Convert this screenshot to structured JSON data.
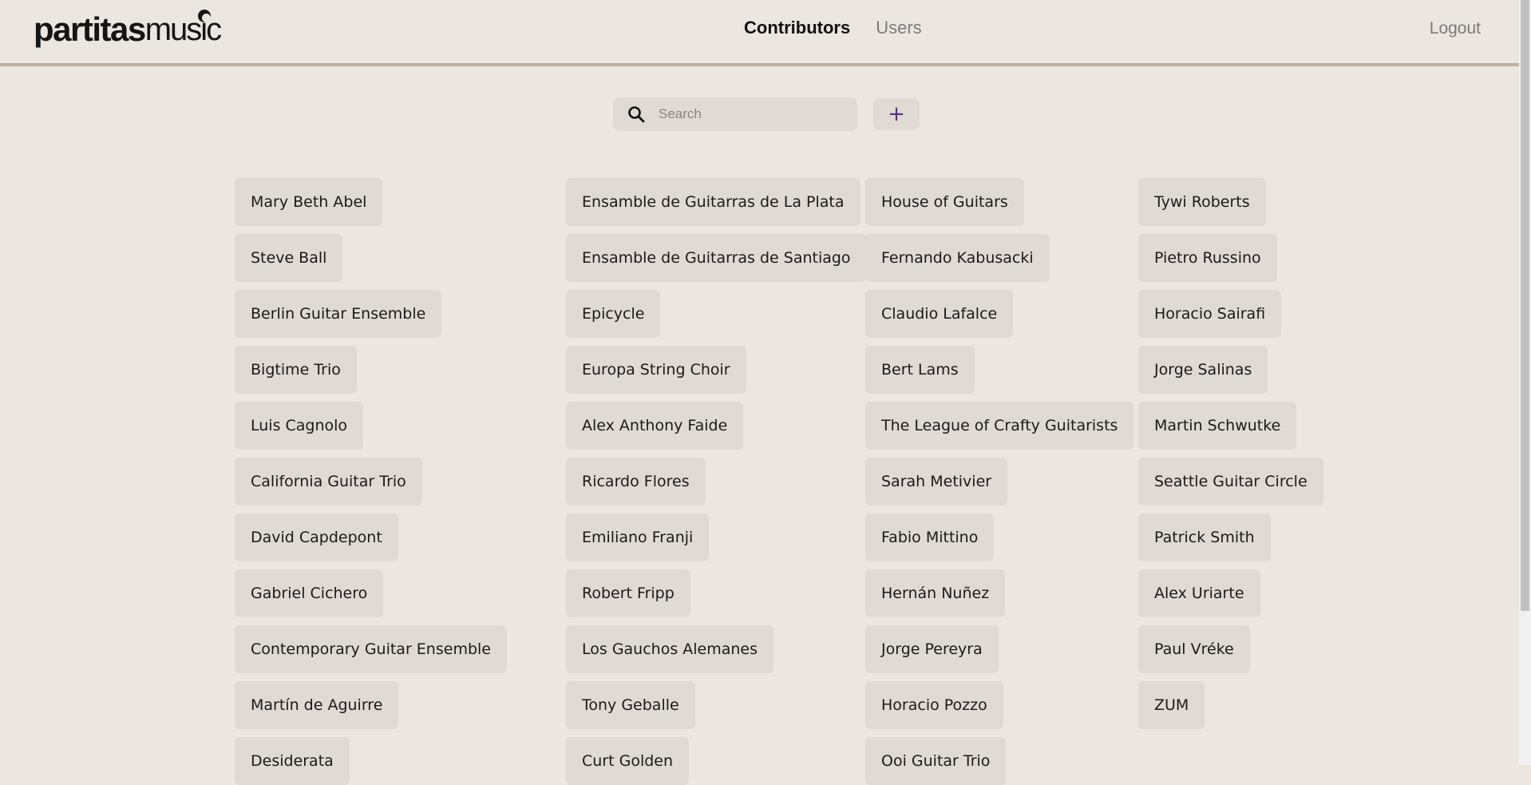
{
  "header": {
    "logo_bold": "partitas",
    "logo_thin": "music",
    "tabs": [
      {
        "label": "Contributors",
        "active": true
      },
      {
        "label": "Users",
        "active": false
      }
    ],
    "logout_label": "Logout"
  },
  "search": {
    "placeholder": "Search",
    "value": "",
    "add_label": "+"
  },
  "contributors": [
    [
      "Mary Beth Abel",
      "Steve Ball",
      "Berlin Guitar Ensemble",
      "Bigtime Trio",
      "Luis Cagnolo",
      "California Guitar Trio",
      "David Capdepont",
      "Gabriel Cichero",
      "Contemporary Guitar Ensemble",
      "Martín de Aguirre",
      "Desiderata"
    ],
    [
      "Ensamble de Guitarras de La Plata",
      "Ensamble de Guitarras de Santiago",
      "Epicycle",
      "Europa String Choir",
      "Alex Anthony Faide",
      "Ricardo Flores",
      "Emiliano Franji",
      "Robert Fripp",
      "Los Gauchos Alemanes",
      "Tony Geballe",
      "Curt Golden"
    ],
    [
      "House of Guitars",
      "Fernando Kabusacki",
      "Claudio Lafalce",
      "Bert Lams",
      "The League of Crafty Guitarists",
      "Sarah Metivier",
      "Fabio Mittino",
      "Hernán Nuñez",
      "Jorge Pereyra",
      "Horacio Pozzo",
      "Ooi Guitar Trio"
    ],
    [
      "Tywi Roberts",
      "Pietro Russino",
      "Horacio Sairafi",
      "Jorge Salinas",
      "Martin Schwutke",
      "Seattle Guitar Circle",
      "Patrick Smith",
      "Alex Uriarte",
      "Paul Vréke",
      "ZUM"
    ]
  ],
  "colors": {
    "background": "#ebe7e0",
    "chip": "#dfdad4",
    "header_border": "#bfae9f",
    "accent": "#5b2a86"
  },
  "icons": {
    "search": "search-icon",
    "add": "plus-icon"
  }
}
